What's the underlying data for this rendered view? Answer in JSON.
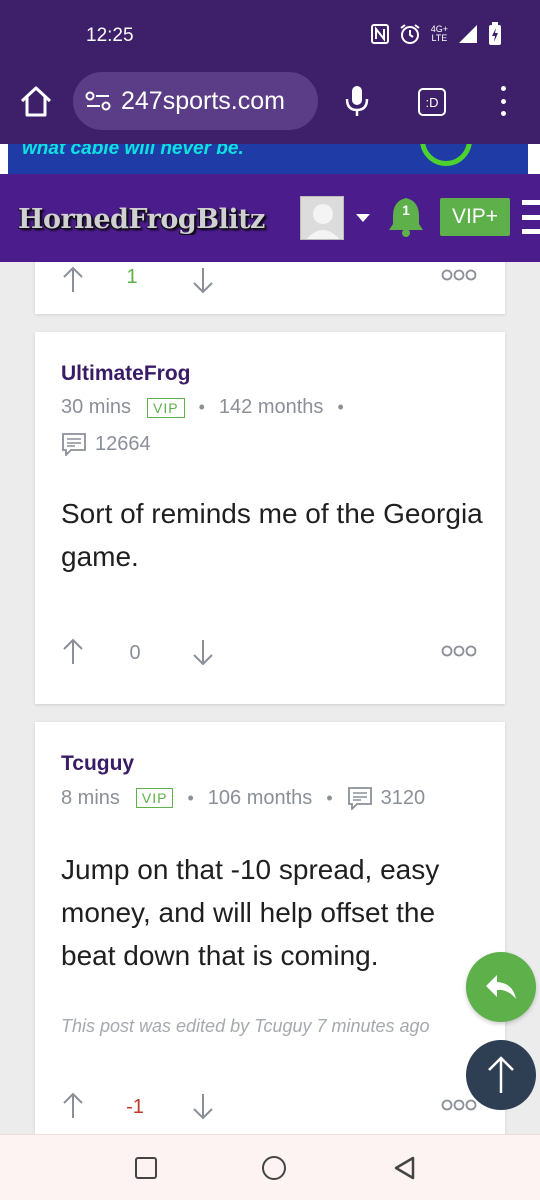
{
  "status_bar": {
    "time": "12:25",
    "network_label_top": "4G+",
    "network_label_bottom": "LTE"
  },
  "browser": {
    "url": "247sports.com",
    "tab_label": ":D"
  },
  "ad": {
    "text": "what cable will never be."
  },
  "site": {
    "logo_text": "HornedFrogBlitz",
    "notification_count": "1",
    "vip_plus_label": "VIP+"
  },
  "posts": [
    {
      "author": "UltimateFrog",
      "time_ago": "30 mins",
      "badge": "VIP",
      "member_months": "142 months",
      "post_count": "12664",
      "body": "Sort of reminds me of the Georgia game.",
      "vote_count": "0"
    },
    {
      "author": "Tcuguy",
      "time_ago": "8 mins",
      "badge": "VIP",
      "member_months": "106 months",
      "post_count": "3120",
      "body": "Jump on that -10 spread, easy money, and will help offset the beat down that is coming.",
      "edited_note": "This post was edited by Tcuguy 7 minutes ago",
      "vote_count": "-1"
    }
  ],
  "prev_post": {
    "vote_count": "1"
  },
  "colors": {
    "brand_purple": "#4b1c8c",
    "browser_purple": "#3d1f6a",
    "vip_green": "#5db04a",
    "author_color": "#3a1b66",
    "negative_vote": "#c0392b"
  }
}
